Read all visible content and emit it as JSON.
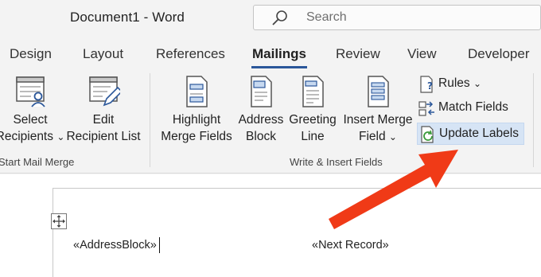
{
  "window": {
    "title": "Document1  -  Word"
  },
  "search": {
    "placeholder": "Search"
  },
  "tabs": [
    {
      "label": "Design"
    },
    {
      "label": "Layout"
    },
    {
      "label": "References"
    },
    {
      "label": "Mailings",
      "active": true
    },
    {
      "label": "Review"
    },
    {
      "label": "View"
    },
    {
      "label": "Developer"
    }
  ],
  "ribbon": {
    "start_group": {
      "label": "Start Mail Merge",
      "select_recipients": {
        "line1": "Select",
        "line2": "Recipients",
        "chevron": "⌄"
      },
      "edit_recipients": {
        "line1": "Edit",
        "line2": "Recipient List"
      }
    },
    "write_group": {
      "label": "Write & Insert Fields",
      "highlight": {
        "line1": "Highlight",
        "line2": "Merge Fields"
      },
      "address": {
        "line1": "Address",
        "line2": "Block"
      },
      "greeting": {
        "line1": "Greeting",
        "line2": "Line"
      },
      "insert_merge": {
        "line1": "Insert Merge",
        "line2": "Field",
        "chevron": "⌄"
      },
      "rules": {
        "label": "Rules",
        "chevron": "⌄"
      },
      "match_fields": {
        "label": "Match Fields"
      },
      "update_labels": {
        "label": "Update Labels"
      }
    }
  },
  "document": {
    "address_field": "«AddressBlock»",
    "next_record_field": "«Next Record»"
  },
  "colors": {
    "accent": "#2b579a",
    "highlight": "#d6e4f5",
    "arrow": "#f03a17"
  }
}
